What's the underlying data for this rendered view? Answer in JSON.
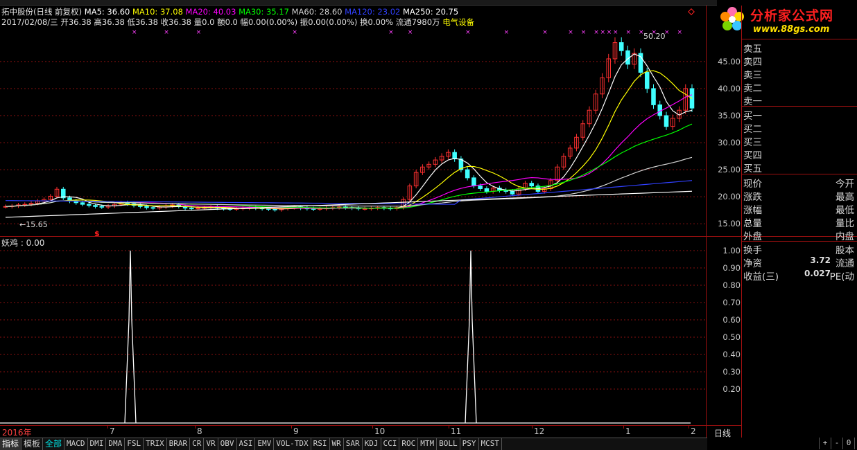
{
  "header": {
    "stock_title": "拓中股份(日线 前复权)",
    "ma": [
      {
        "label": "MA5: 36.60",
        "color": "#ffffff"
      },
      {
        "label": "MA10: 37.08",
        "color": "#ffff00"
      },
      {
        "label": "MA20: 40.03",
        "color": "#ff00ff"
      },
      {
        "label": "MA30: 35.17",
        "color": "#00ff00"
      },
      {
        "label": "MA60: 28.60",
        "color": "#d0d0d0"
      },
      {
        "label": "MA120: 23.02",
        "color": "#3040ff"
      },
      {
        "label": "MA250: 20.75",
        "color": "#ffffff"
      }
    ],
    "date_line": "2017/02/08/三",
    "ohlc_line": "开36.38 高36.38 低36.38 收36.38",
    "vol_line": "量0.0 额0.0 幅0.00(0.00%) 振0.00(0.00%) 换0.00% 流通7980万",
    "sector": "电气设备",
    "sector_color": "#ffff00"
  },
  "logo": {
    "name": "分析家公式网",
    "url": "www.88gs.com"
  },
  "price_axis": [
    "50.20",
    "45.00",
    "40.00",
    "35.00",
    "30.00",
    "25.00",
    "20.00",
    "15.00"
  ],
  "low_label": "15.65",
  "signal_marker": "$",
  "indicator": {
    "title": "妖鸡 : 0.00"
  },
  "ind_axis": [
    "1.00",
    "0.90",
    "0.80",
    "0.70",
    "0.60",
    "0.50",
    "0.40",
    "0.30",
    "0.20"
  ],
  "x_axis": [
    "2016年",
    "7",
    "8",
    "9",
    "10",
    "11",
    "12",
    "1",
    "2"
  ],
  "right_panel": {
    "sell": [
      "卖五",
      "卖四",
      "卖三",
      "卖二",
      "卖一"
    ],
    "buy": [
      "买一",
      "买二",
      "买三",
      "买四",
      "买五"
    ],
    "quote_left": [
      "现价",
      "涨跌",
      "涨幅",
      "总量",
      "外盘"
    ],
    "quote_right": [
      "今开",
      "最高",
      "最低",
      "量比",
      "内盘"
    ],
    "extra": [
      {
        "l": "换手",
        "v": "",
        "r": "股本"
      },
      {
        "l": "净资",
        "v": "3.72",
        "r": "流通"
      },
      {
        "l": "收益(三)",
        "v": "0.027",
        "r": "PE(动"
      }
    ],
    "period": "日线"
  },
  "tabs": [
    "指标",
    "模板",
    "全部",
    "MACD",
    "DMI",
    "DMA",
    "FSL",
    "TRIX",
    "BRAR",
    "CR",
    "VR",
    "OBV",
    "ASI",
    "EMV",
    "VOL-TDX",
    "RSI",
    "WR",
    "SAR",
    "KDJ",
    "CCI",
    "ROC",
    "MTM",
    "BOLL",
    "PSY",
    "MCST"
  ],
  "corner_tabs": [
    "+",
    "-",
    "0"
  ],
  "chart_data": {
    "type": "candlestick",
    "main": {
      "ylim": [
        13.5,
        51
      ],
      "annotations": [
        "50.20",
        "15.65"
      ],
      "closes_approx": [
        18.2,
        18.3,
        18.5,
        18.6,
        18.8,
        19.2,
        19.5,
        20.1,
        21.4,
        19.8,
        19.2,
        18.9,
        18.6,
        18.4,
        18.2,
        18.1,
        18.3,
        18.6,
        18.9,
        18.7,
        18.4,
        18.2,
        18.0,
        17.9,
        18.1,
        18.3,
        18.5,
        18.2,
        17.9,
        17.8,
        17.9,
        18.0,
        18.1,
        17.9,
        17.8,
        17.7,
        17.8,
        17.9,
        18.0,
        17.9,
        17.8,
        17.7,
        17.6,
        17.8,
        18.0,
        18.1,
        17.9,
        17.8,
        17.7,
        17.8,
        17.9,
        18.0,
        18.1,
        18.0,
        17.9,
        17.8,
        17.8,
        17.9,
        18.0,
        17.9,
        17.8,
        18.0,
        19.5,
        22.0,
        24.5,
        25.5,
        26.0,
        26.8,
        27.5,
        28.2,
        27.0,
        25.0,
        23.5,
        22.0,
        21.5,
        21.0,
        21.6,
        21.2,
        21.0,
        20.5,
        21.5,
        22.5,
        22.0,
        21.0,
        21.5,
        23.0,
        25.5,
        27.5,
        29.0,
        31.0,
        33.5,
        36.0,
        39.0,
        42.0,
        45.5,
        48.5,
        47.0,
        44.5,
        46.5,
        43.0,
        40.0,
        37.0,
        35.0,
        33.0,
        34.5,
        36.0,
        40.0,
        36.4
      ]
    },
    "indicator": {
      "name": "妖鸡",
      "value": 0.0,
      "ylim": [
        0,
        1.05
      ],
      "spikes": [
        {
          "x": "7月中",
          "value": 1.0
        },
        {
          "x": "11月初",
          "value": 1.0
        }
      ]
    }
  }
}
